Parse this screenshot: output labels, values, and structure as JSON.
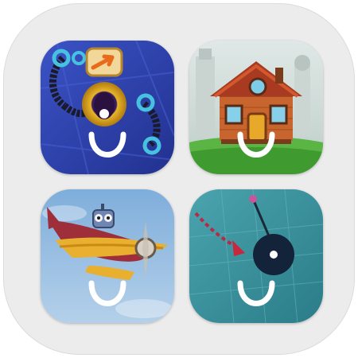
{
  "bundle": {
    "apps": [
      {
        "id": "puzzle-pipes",
        "icon": "pipe-puzzle-icon",
        "accent": "#2f3fa8"
      },
      {
        "id": "house",
        "icon": "house-icon",
        "accent": "#4caa3a"
      },
      {
        "id": "airplane",
        "icon": "airplane-icon",
        "accent": "#8fb7dc"
      },
      {
        "id": "pendulum",
        "icon": "pendulum-icon",
        "accent": "#3a8f9a"
      }
    ],
    "brand_mark": "smile-icon",
    "colors": {
      "bundle_background": "#ececec",
      "smile": "#ffffff"
    }
  }
}
